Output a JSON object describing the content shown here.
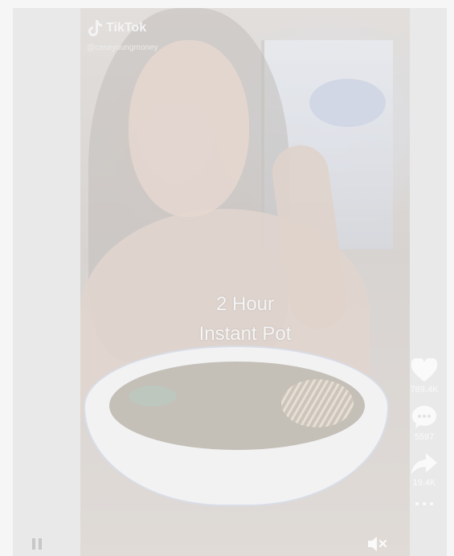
{
  "video": {
    "brand": "TikTok",
    "handle": "@caseyoungmoney",
    "caption": {
      "line1": "2 Hour",
      "line2": "Instant Pot"
    }
  },
  "actions": {
    "likes": "789.4K",
    "comments": "5597",
    "shares": "19.4K"
  },
  "icons": {
    "logo": "tiktok-note-icon",
    "like": "heart-icon",
    "comment": "comment-bubble-icon",
    "share": "share-arrow-icon",
    "more": "more-dots-icon",
    "mute": "mute-speaker-icon"
  },
  "colors": {
    "overlay_text": "#f5f5f5",
    "card_background": "#e9e9ea"
  }
}
